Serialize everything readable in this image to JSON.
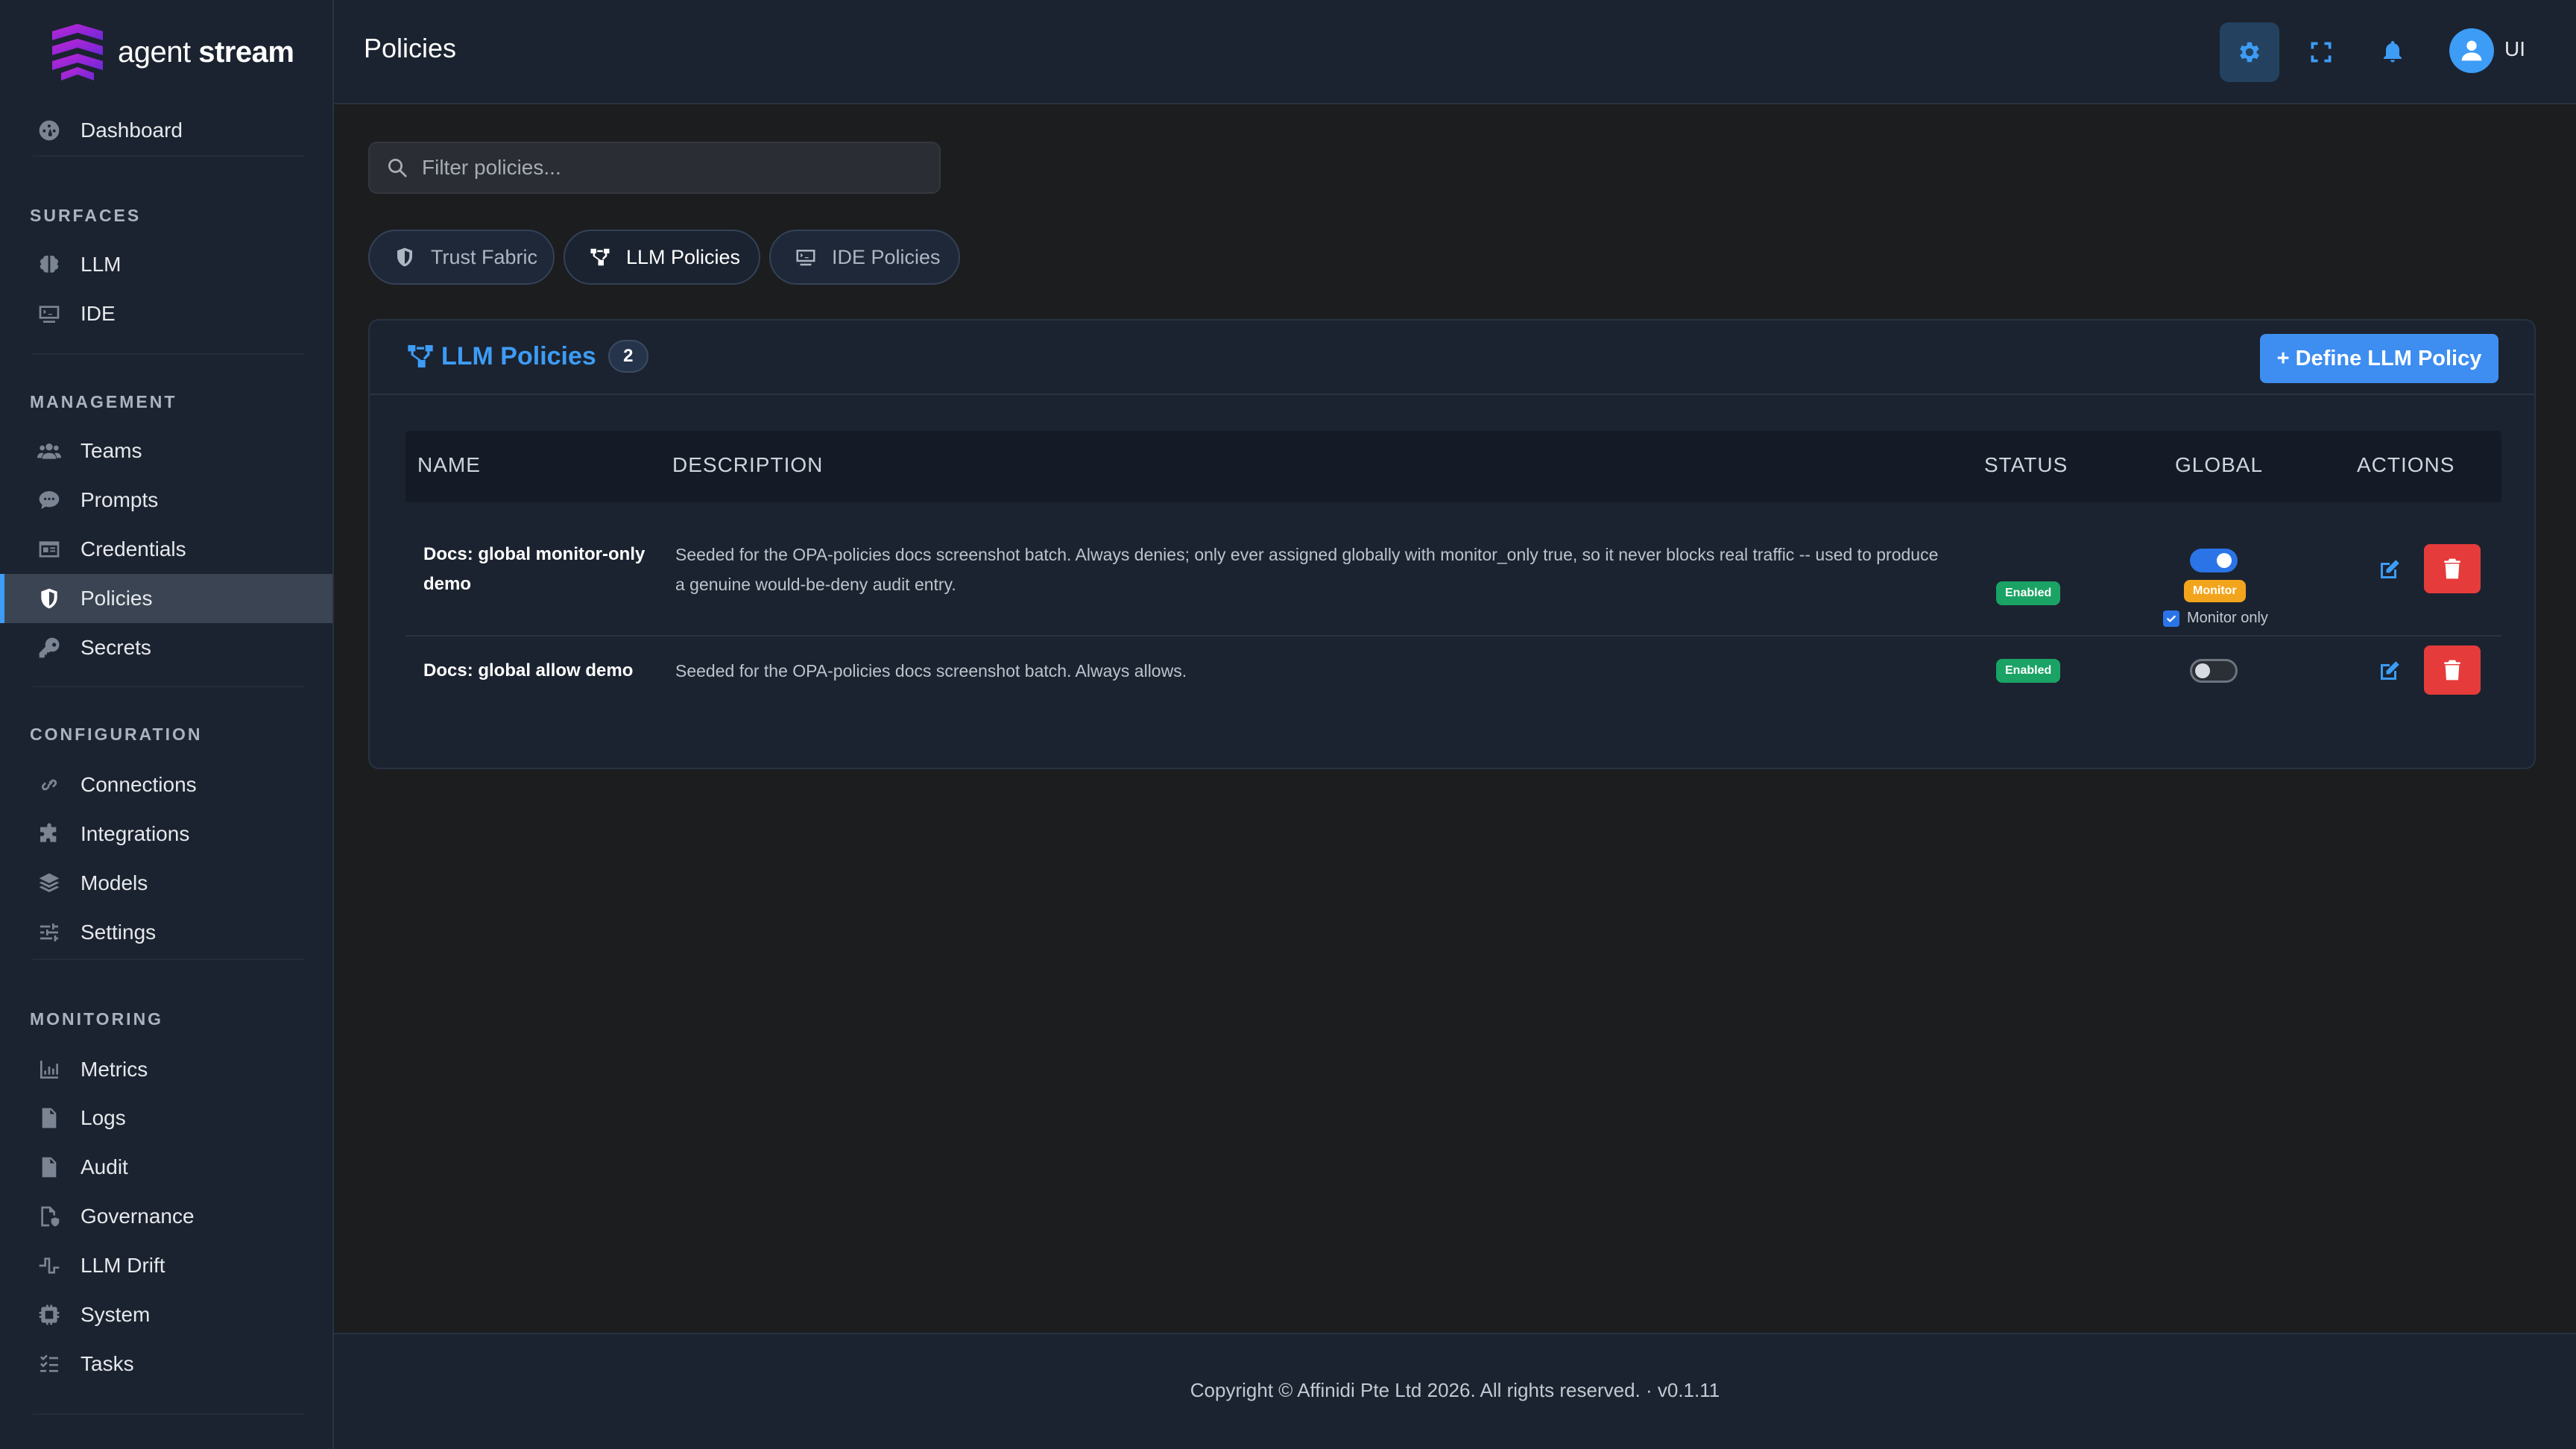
{
  "brand": {
    "name_light": "agent",
    "name_bold": "stream",
    "accent": "#7c3aed"
  },
  "header": {
    "title": "Policies",
    "user_initials": "UI"
  },
  "sidebar": {
    "top": [
      {
        "label": "Dashboard",
        "icon": "dashboard-icon"
      }
    ],
    "sections": [
      {
        "title": "SURFACES",
        "items": [
          {
            "label": "LLM",
            "icon": "brain-icon"
          },
          {
            "label": "IDE",
            "icon": "monitor-code-icon"
          }
        ]
      },
      {
        "title": "MANAGEMENT",
        "items": [
          {
            "label": "Teams",
            "icon": "users-icon"
          },
          {
            "label": "Prompts",
            "icon": "chat-icon"
          },
          {
            "label": "Credentials",
            "icon": "id-card-icon"
          },
          {
            "label": "Policies",
            "icon": "shield-icon",
            "active": true
          },
          {
            "label": "Secrets",
            "icon": "key-icon"
          }
        ]
      },
      {
        "title": "CONFIGURATION",
        "items": [
          {
            "label": "Connections",
            "icon": "link-icon"
          },
          {
            "label": "Integrations",
            "icon": "puzzle-icon"
          },
          {
            "label": "Models",
            "icon": "layers-icon"
          },
          {
            "label": "Settings",
            "icon": "sliders-icon"
          }
        ]
      },
      {
        "title": "MONITORING",
        "items": [
          {
            "label": "Metrics",
            "icon": "chart-icon"
          },
          {
            "label": "Logs",
            "icon": "file-icon"
          },
          {
            "label": "Audit",
            "icon": "file-check-icon"
          },
          {
            "label": "Governance",
            "icon": "file-shield-icon"
          },
          {
            "label": "LLM Drift",
            "icon": "pulse-icon"
          },
          {
            "label": "System",
            "icon": "chip-icon"
          },
          {
            "label": "Tasks",
            "icon": "list-check-icon"
          }
        ]
      }
    ]
  },
  "main": {
    "filter": {
      "placeholder": "Filter policies..."
    },
    "tabs": [
      {
        "label": "Trust Fabric",
        "icon": "shield-half-icon"
      },
      {
        "label": "LLM Policies",
        "icon": "diagram-icon",
        "active": true
      },
      {
        "label": "IDE Policies",
        "icon": "monitor-code-icon"
      }
    ],
    "panel": {
      "title": "LLM Policies",
      "count": "2",
      "define_button": "+ Define LLM Policy",
      "columns": [
        "NAME",
        "DESCRIPTION",
        "STATUS",
        "GLOBAL",
        "ACTIONS"
      ],
      "rows": [
        {
          "name": "Docs: global monitor-only demo",
          "description": "Seeded for the OPA-policies docs screenshot batch. Always denies; only ever assigned globally with monitor_only true, so it never blocks real traffic -- used to produce a genuine would-be-deny audit entry.",
          "status": "Enabled",
          "global": true,
          "monitor_badge": "Monitor",
          "monitor_only_label": "Monitor only",
          "monitor_only": true
        },
        {
          "name": "Docs: global allow demo",
          "description": "Seeded for the OPA-policies docs screenshot batch. Always allows.",
          "status": "Enabled",
          "global": false
        }
      ]
    }
  },
  "footer": {
    "copyright": "Copyright © Affinidi Pte Ltd 2026. All rights reserved. · v0.1.11"
  },
  "colors": {
    "primary": "#3d8ef0",
    "success": "#1aa365",
    "warning": "#f2a51c",
    "danger": "#e63b3b"
  }
}
